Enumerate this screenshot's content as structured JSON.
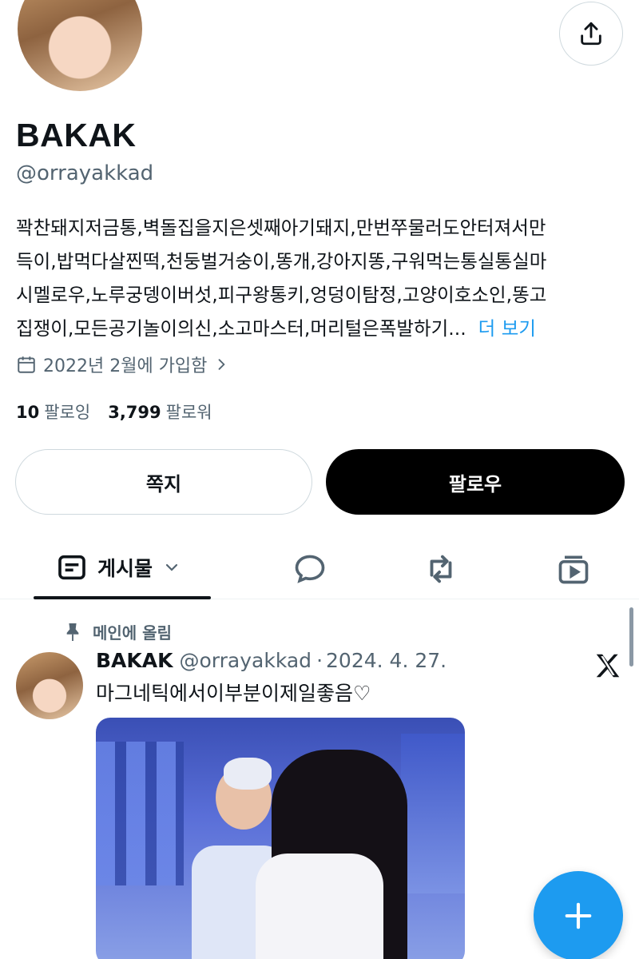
{
  "profile": {
    "display_name": "BAKAK",
    "handle": "@orrayakkad",
    "bio_lines": [
      "꽉찬돼지저금통,벽돌집을지은셋째아기돼지,만번쭈물러도안터져서만",
      "득이,밥먹다살찐떡,천둥벌거숭이,똥개,강아지똥,구워먹는통실통실마",
      "시멜로우,노루궁뎅이버섯,피구왕통키,엉덩이탐정,고양이호소인,똥고",
      "집쟁이,모든공기놀이의신,소고마스터,머리털은폭발하기..."
    ],
    "bio_more": "더 보기",
    "joined": "2022년 2월에 가입함",
    "following_count": "10",
    "following_label": "팔로잉",
    "followers_count": "3,799",
    "followers_label": "팔로워"
  },
  "buttons": {
    "message": "쪽지",
    "follow": "팔로우"
  },
  "tabs": {
    "posts_label": "게시물"
  },
  "post": {
    "pinned_label": "메인에 올림",
    "author_name": "BAKAK",
    "author_handle": "@orrayakkad",
    "separator": "·",
    "date": "2024. 4. 27.",
    "text": "마그네틱에서이부분이제일좋음♡"
  },
  "icons": {
    "share": "share-icon",
    "calendar": "calendar-icon",
    "chevron": "chevron-right-icon",
    "posts_tab": "posts-icon",
    "replies_tab": "speech-bubble-icon",
    "reposts_tab": "repost-icon",
    "media_tab": "video-icon",
    "pin": "pin-icon",
    "source": "x-logo-icon",
    "compose": "plus-icon"
  },
  "colors": {
    "accent": "#1d9bf0",
    "text_primary": "#0f1419",
    "text_secondary": "#536471",
    "follow_bg": "#000000"
  }
}
